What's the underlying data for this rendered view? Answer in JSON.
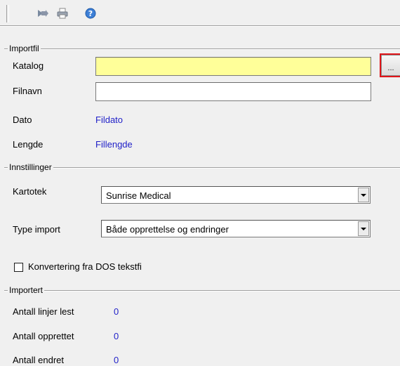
{
  "toolbar": {
    "icons": [
      "import-icon",
      "print-icon",
      "help-icon"
    ]
  },
  "importfil": {
    "title": "Importfil",
    "katalog_label": "Katalog",
    "katalog_value": "",
    "browse_label": "...",
    "filnavn_label": "Filnavn",
    "filnavn_value": "",
    "dato_label": "Dato",
    "dato_value": "Fildato",
    "lengde_label": "Lengde",
    "lengde_value": "Fillengde"
  },
  "innstillinger": {
    "title": "Innstillinger",
    "kartotek_label": "Kartotek",
    "kartotek_value": "Sunrise Medical",
    "type_label": "Type import",
    "type_value": "Både opprettelse og endringer",
    "dos_label": "Konvertering fra DOS tekstfi",
    "dos_checked": false
  },
  "importert": {
    "title": "Importert",
    "linjer_label": "Antall linjer lest",
    "linjer_value": "0",
    "opprettet_label": "Antall opprettet",
    "opprettet_value": "0",
    "endret_label": "Antall endret",
    "endret_value": "0"
  },
  "colors": {
    "field_highlight": "#ffff99",
    "link_blue": "#1f1fc8",
    "focus_border": "#e0161b"
  }
}
